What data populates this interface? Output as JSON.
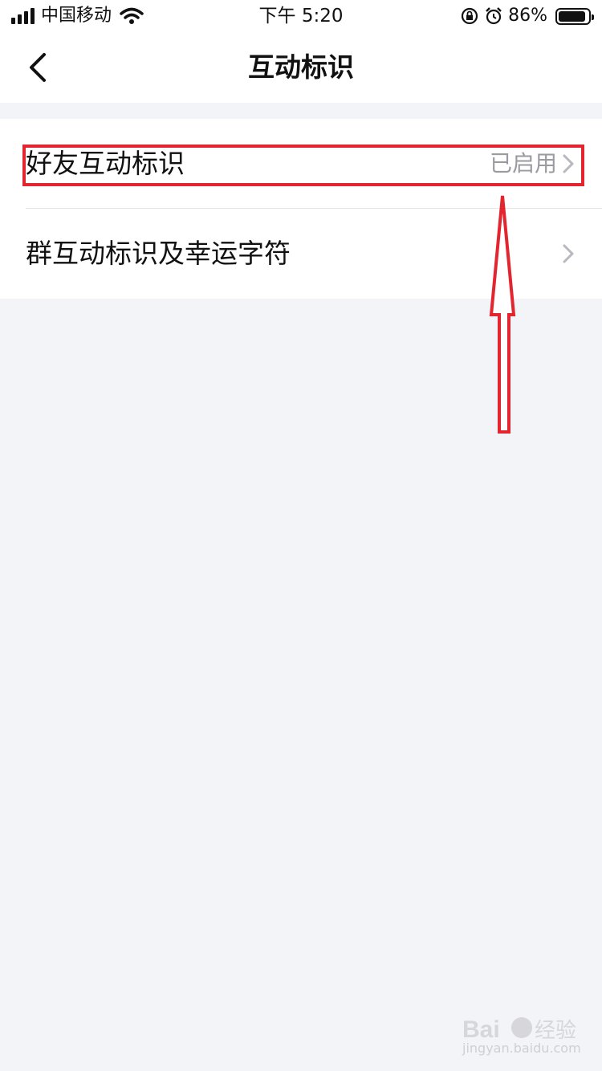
{
  "status_bar": {
    "carrier": "中国移动",
    "time": "下午 5:20",
    "battery_percent": "86%",
    "icons": [
      "signal-icon",
      "wifi-icon",
      "orientation-lock-icon",
      "alarm-icon",
      "battery-icon"
    ]
  },
  "nav": {
    "title": "互动标识",
    "back_icon": "chevron-left-icon"
  },
  "list": {
    "items": [
      {
        "label": "好友互动标识",
        "value": "已启用",
        "icon": "chevron-right-icon"
      },
      {
        "label": "群互动标识及幸运字符",
        "value": "",
        "icon": "chevron-right-icon"
      }
    ]
  },
  "annotation": {
    "highlight_color": "#e3252f",
    "arrow_color": "#e3252f"
  },
  "watermark": {
    "logo": "Bai du 经验",
    "url": "jingyan.baidu.com"
  }
}
